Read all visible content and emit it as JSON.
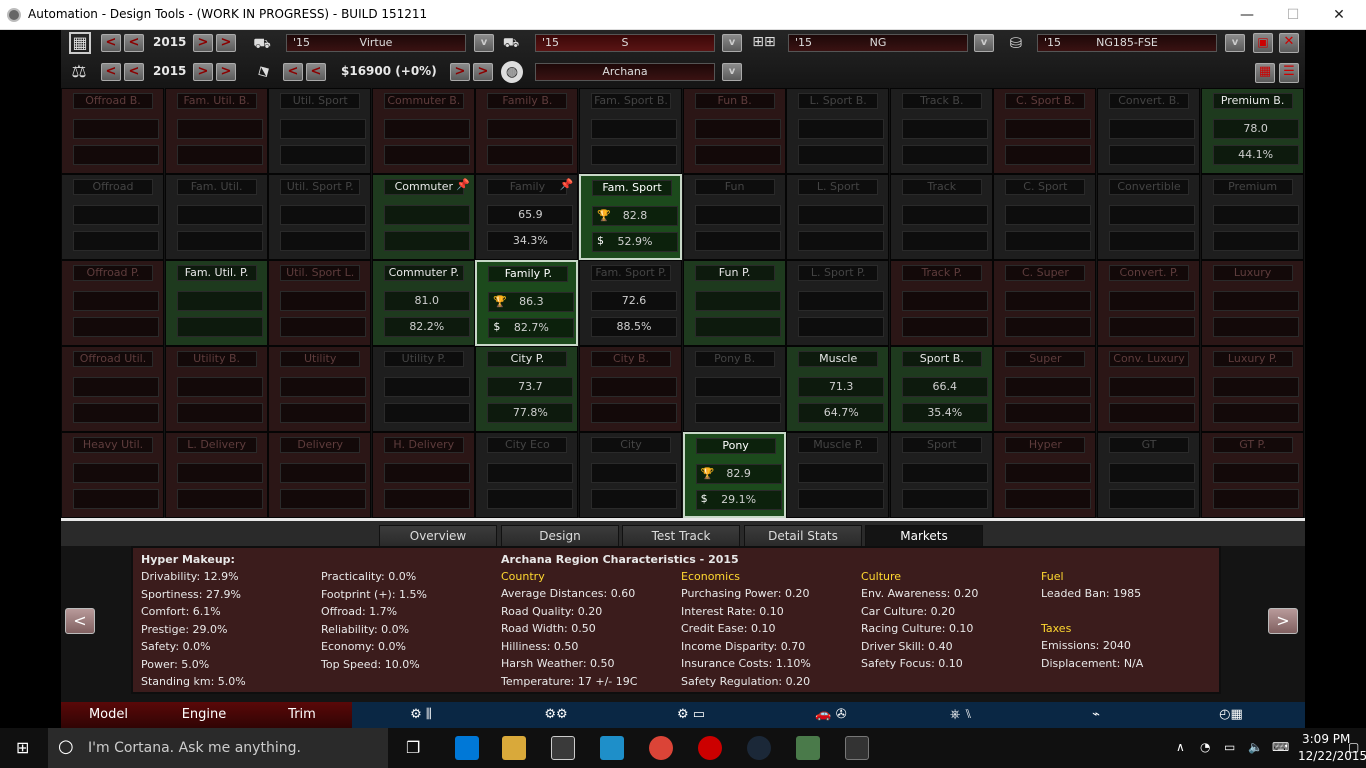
{
  "window": {
    "title": "Automation - Design Tools - (WORK IN PROGRESS) - BUILD 151211",
    "minimize": "—",
    "maximize": "☐",
    "close": "✕"
  },
  "top": {
    "year1": "2015",
    "year2": "2015",
    "price": "$16900 (+0%)",
    "model": {
      "year": "'15",
      "name": "Virtue"
    },
    "trim": {
      "year": "'15",
      "name": "S"
    },
    "body": {
      "year": "'15",
      "name": "NG"
    },
    "engine": {
      "year": "'15",
      "name": "NG185-FSE"
    },
    "region": "Archana",
    "icons": {
      "calendar": "▦",
      "scale": "⚖",
      "car": "car-icon",
      "van": "van-icon",
      "ladder": "chassis-icon",
      "seat": "seat-icon",
      "tag": "price-tag-icon",
      "globe": "globe-icon",
      "save": "save-icon",
      "close": "close-icon",
      "grid": "grid-view-icon",
      "list": "list-view-icon"
    },
    "arrows": {
      "prev": "<",
      "next": ">",
      "down": "v"
    }
  },
  "grid": [
    [
      {
        "l": "Offroad B.",
        "s": "bad"
      },
      {
        "l": "Fam. Util. B.",
        "s": "bad"
      },
      {
        "l": "Util. Sport",
        "s": "neu"
      },
      {
        "l": "Commuter B.",
        "s": "bad"
      },
      {
        "l": "Family B.",
        "s": "bad"
      },
      {
        "l": "Fam. Sport B.",
        "s": "neu"
      },
      {
        "l": "Fun B.",
        "s": "bad"
      },
      {
        "l": "L. Sport B.",
        "s": "neu"
      },
      {
        "l": "Track B.",
        "s": "neu"
      },
      {
        "l": "C. Sport B.",
        "s": "bad"
      },
      {
        "l": "Convert. B.",
        "s": "neu"
      },
      {
        "l": "Premium B.",
        "s": "good",
        "a": "78.0",
        "b": "44.1%"
      }
    ],
    [
      {
        "l": "Offroad",
        "s": "neu"
      },
      {
        "l": "Fam. Util.",
        "s": "neu"
      },
      {
        "l": "Util. Sport P.",
        "s": "neu"
      },
      {
        "l": "Commuter",
        "s": "good",
        "pin": true
      },
      {
        "l": "Family",
        "s": "neu",
        "a": "65.9",
        "b": "34.3%",
        "pin": true
      },
      {
        "l": "Fam. Sport",
        "s": "sel",
        "a": "82.8",
        "b": "52.9%",
        "icons": true
      },
      {
        "l": "Fun",
        "s": "neu"
      },
      {
        "l": "L. Sport",
        "s": "neu"
      },
      {
        "l": "Track",
        "s": "neu"
      },
      {
        "l": "C. Sport",
        "s": "neu"
      },
      {
        "l": "Convertible",
        "s": "neu"
      },
      {
        "l": "Premium",
        "s": "neu"
      }
    ],
    [
      {
        "l": "Offroad P.",
        "s": "bad"
      },
      {
        "l": "Fam. Util. P.",
        "s": "good"
      },
      {
        "l": "Util. Sport L.",
        "s": "bad"
      },
      {
        "l": "Commuter P.",
        "s": "good",
        "a": "81.0",
        "b": "82.2%"
      },
      {
        "l": "Family P.",
        "s": "sel",
        "a": "86.3",
        "b": "82.7%",
        "icons": true
      },
      {
        "l": "Fam. Sport P.",
        "s": "neu",
        "a": "72.6",
        "b": "88.5%"
      },
      {
        "l": "Fun P.",
        "s": "good"
      },
      {
        "l": "L. Sport P.",
        "s": "neu"
      },
      {
        "l": "Track P.",
        "s": "bad"
      },
      {
        "l": "C. Super",
        "s": "bad"
      },
      {
        "l": "Convert. P.",
        "s": "bad"
      },
      {
        "l": "Luxury",
        "s": "bad"
      }
    ],
    [
      {
        "l": "Offroad Util.",
        "s": "bad"
      },
      {
        "l": "Utility B.",
        "s": "bad"
      },
      {
        "l": "Utility",
        "s": "bad"
      },
      {
        "l": "Utility P.",
        "s": "neu"
      },
      {
        "l": "City P.",
        "s": "good",
        "a": "73.7",
        "b": "77.8%"
      },
      {
        "l": "City B.",
        "s": "bad"
      },
      {
        "l": "Pony B.",
        "s": "neu"
      },
      {
        "l": "Muscle",
        "s": "good",
        "a": "71.3",
        "b": "64.7%"
      },
      {
        "l": "Sport B.",
        "s": "good",
        "a": "66.4",
        "b": "35.4%"
      },
      {
        "l": "Super",
        "s": "bad"
      },
      {
        "l": "Conv. Luxury",
        "s": "bad"
      },
      {
        "l": "Luxury P.",
        "s": "bad"
      }
    ],
    [
      {
        "l": "Heavy Util.",
        "s": "bad"
      },
      {
        "l": "L. Delivery",
        "s": "bad"
      },
      {
        "l": "Delivery",
        "s": "bad"
      },
      {
        "l": "H. Delivery",
        "s": "bad"
      },
      {
        "l": "City Eco",
        "s": "neu"
      },
      {
        "l": "City",
        "s": "neu"
      },
      {
        "l": "Pony",
        "s": "sel",
        "a": "82.9",
        "b": "29.1%",
        "icons": true
      },
      {
        "l": "Muscle P.",
        "s": "neu"
      },
      {
        "l": "Sport",
        "s": "neu"
      },
      {
        "l": "Hyper",
        "s": "bad"
      },
      {
        "l": "GT",
        "s": "neu"
      },
      {
        "l": "GT P.",
        "s": "bad"
      }
    ]
  ],
  "tabs": [
    "Overview",
    "Design",
    "Test Track",
    "Detail Stats",
    "Markets"
  ],
  "panel": {
    "makeup_title": "Hyper Makeup:",
    "makeup_col1": [
      "Drivability: 12.9%",
      "Sportiness: 27.9%",
      "Comfort: 6.1%",
      "Prestige: 29.0%",
      "Safety: 0.0%",
      "Power: 5.0%",
      "Standing km: 5.0%"
    ],
    "makeup_col2": [
      "Practicality: 0.0%",
      "Footprint (+): 1.5%",
      "Offroad: 1.7%",
      "Reliability: 0.0%",
      "Economy: 0.0%",
      "Top Speed: 10.0%"
    ],
    "region_title": "Archana Region Characteristics - 2015",
    "country_h": "Country",
    "country": [
      "Average Distances: 0.60",
      "Road Quality: 0.20",
      "Road Width: 0.50",
      "Hilliness: 0.50",
      "Harsh Weather: 0.50",
      "Temperature: 17 +/- 19C"
    ],
    "econ_h": "Economics",
    "econ": [
      "Purchasing Power: 0.20",
      "Interest Rate: 0.10",
      "Credit Ease: 0.10",
      "Income Disparity: 0.70",
      "Insurance Costs: 1.10%",
      "Safety Regulation: 0.20"
    ],
    "culture_h": "Culture",
    "culture": [
      "Env. Awareness: 0.20",
      "Car Culture: 0.20",
      "Racing Culture: 0.10",
      "Driver Skill: 0.40",
      "Safety Focus: 0.10"
    ],
    "fuel_h": "Fuel",
    "fuel": [
      "Leaded Ban: 1985"
    ],
    "taxes_h": "Taxes",
    "taxes": [
      "Emissions: 2040",
      "Displacement: N/A"
    ],
    "prev": "<",
    "next": ">"
  },
  "nav": [
    "Model",
    "Engine",
    "Trim"
  ],
  "taskbar": {
    "search": "I'm Cortana. Ask me anything.",
    "time": "3:09 PM",
    "date": "12/22/2015"
  }
}
